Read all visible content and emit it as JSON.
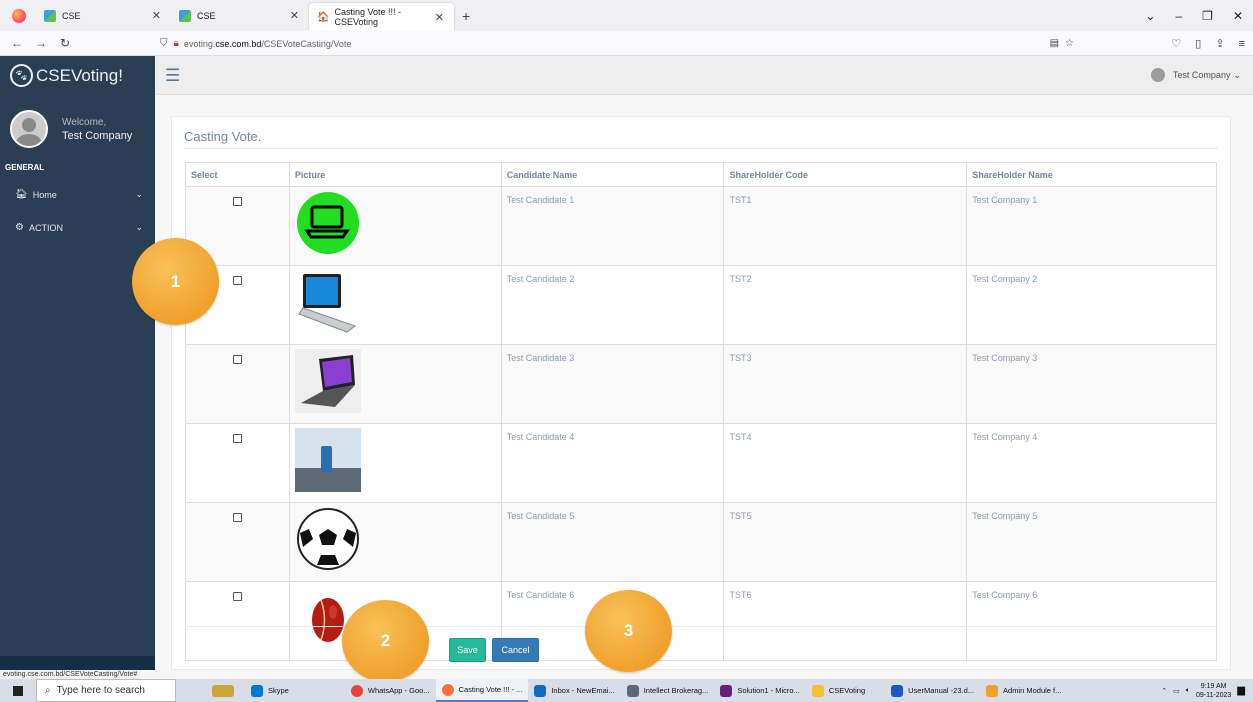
{
  "browser": {
    "tabs": [
      {
        "label": "CSE",
        "active": false
      },
      {
        "label": "CSE",
        "active": false
      },
      {
        "label": "Casting Vote !!! - CSEVoting",
        "active": true
      }
    ],
    "url_prefix": "evoting.",
    "url_host": "cse.com.bd",
    "url_path": "/CSEVoteCasting/Vote",
    "status_url": "evoting.cse.com.bd/CSEVoteCasting/Vote#"
  },
  "sidebar": {
    "brand": "CSEVoting!",
    "welcome": "Welcome,",
    "user": "Test Company",
    "section": "GENERAL",
    "items": [
      {
        "label": "Home",
        "icon": "home-icon"
      },
      {
        "label": "ACTION",
        "icon": "cogs-icon"
      }
    ]
  },
  "header": {
    "user_menu": "Test Company"
  },
  "panel": {
    "title": "Casting Vote."
  },
  "table": {
    "columns": [
      "Select",
      "Picture",
      "Candidate Name",
      "ShareHolder Code",
      "ShareHolder Name"
    ],
    "rows": [
      {
        "candidate": "Test Candidate 1",
        "code": "TST1",
        "name": "Test Company 1",
        "picture": "green-laptop-icon",
        "checked": false
      },
      {
        "candidate": "Test Candidate 2",
        "code": "TST2",
        "name": "Test Company 2",
        "picture": "laptop-blue-screen",
        "checked": false
      },
      {
        "candidate": "Test Candidate 3",
        "code": "TST3",
        "name": "Test Company 3",
        "picture": "laptop-windows",
        "checked": false
      },
      {
        "candidate": "Test Candidate 4",
        "code": "TST4",
        "name": "Test Company 4",
        "picture": "smartphone",
        "checked": false
      },
      {
        "candidate": "Test Candidate 5",
        "code": "TST5",
        "name": "Test Company 5",
        "picture": "soccer-ball",
        "checked": false
      },
      {
        "candidate": "Test Candidate 6",
        "code": "TST6",
        "name": "Test Company 6",
        "picture": "cricket-ball",
        "checked": false
      }
    ]
  },
  "buttons": {
    "save": "Save",
    "cancel": "Cancel"
  },
  "markers": [
    "1",
    "2",
    "3"
  ],
  "taskbar": {
    "search_placeholder": "Type here to search",
    "items": [
      {
        "label": "Skype",
        "color": "#0078d4"
      },
      {
        "label": "WhatsApp - Goo...",
        "color": "#e8453c"
      },
      {
        "label": "Casting Vote !!! - ...",
        "color": "#ff7139"
      },
      {
        "label": "Inbox - NewEmai...",
        "color": "#0f6cbd"
      },
      {
        "label": "Intellect Brokerag...",
        "color": "#5c6b7a"
      },
      {
        "label": "Solution1 - Micro...",
        "color": "#68217a"
      },
      {
        "label": "CSEVoting",
        "color": "#f2c230"
      },
      {
        "label": "UserManual -23.d...",
        "color": "#185abd"
      },
      {
        "label": "Admin Module f...",
        "color": "#f0a030"
      }
    ],
    "time": "9:19 AM",
    "date": "09-11-2023"
  },
  "colors": {
    "sidebar": "#2a3f54",
    "save": "#26b99a",
    "cancel": "#337ab7",
    "marker": "#f0a02c"
  }
}
